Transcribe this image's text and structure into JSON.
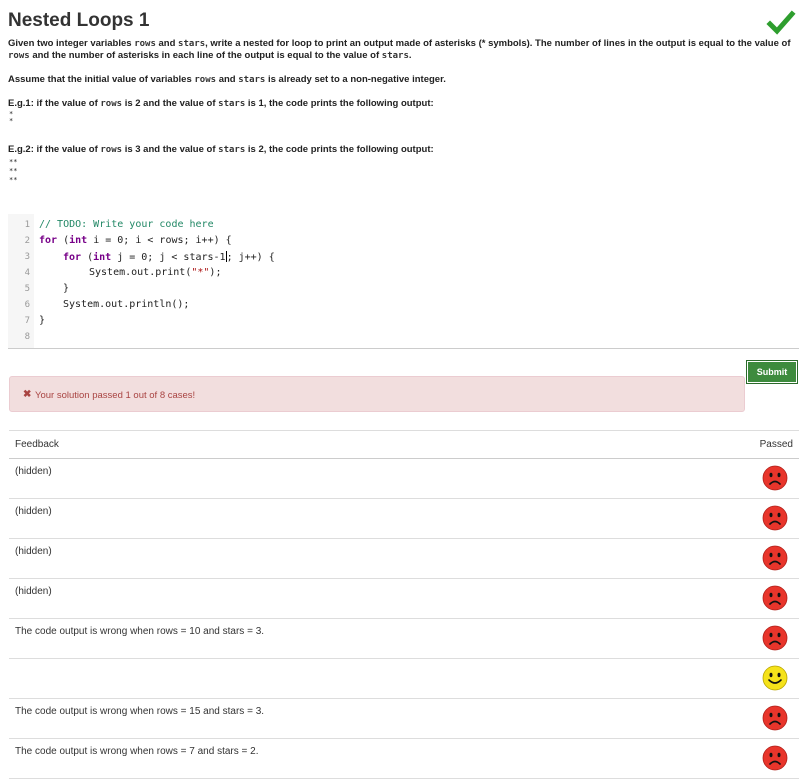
{
  "title": "Nested Loops 1",
  "description": {
    "p1_a": "Given two integer variables ",
    "p1_rows": "rows",
    "p1_b": " and ",
    "p1_stars": "stars",
    "p1_c": ", write a nested for loop to print an output made of asterisks (* symbols). The number of lines in the output is equal to the value of ",
    "p1_rows2": "rows",
    "p1_d": " and the number of asterisks in each line of the output is equal to the value of ",
    "p1_stars2": "stars",
    "p1_e": ".",
    "p2_a": "Assume that the initial value of variables ",
    "p2_rows": "rows",
    "p2_b": " and ",
    "p2_stars": "stars",
    "p2_c": " is already set to a non-negative integer.",
    "eg1_a": "E.g.1: if the value of ",
    "eg1_rows": "rows",
    "eg1_b": " is 2 and the value of ",
    "eg1_stars": "stars",
    "eg1_c": " is 1, the code prints the following output:",
    "eg1_out": [
      "*",
      "*"
    ],
    "eg2_a": "E.g.2: if the value of ",
    "eg2_rows": "rows",
    "eg2_b": " is 3 and the value of ",
    "eg2_stars": "stars",
    "eg2_c": " is 2, the code prints the following output:",
    "eg2_out": [
      "**",
      "**",
      "**"
    ]
  },
  "editor": {
    "line_numbers": [
      "1",
      "2",
      "3",
      "4",
      "5",
      "6",
      "7",
      "8"
    ],
    "lines": {
      "l1": "// TODO: Write your code here",
      "l2_kw1": "for",
      "l2_a": " (",
      "l2_kw2": "int",
      "l2_b": " i = 0; i < rows; i++) {",
      "l3_kw1": "for",
      "l3_a": " (",
      "l3_kw2": "int",
      "l3_b": " j = 0; j < stars-1",
      "l3_c": "; j++) {",
      "l4_a": "System.out.print(",
      "l4_str": "\"*\"",
      "l4_b": ");",
      "l5": "}",
      "l6": "System.out.println();",
      "l7": "}"
    }
  },
  "submit_label": "Submit",
  "alert": {
    "icon": "✖",
    "text": "Your solution passed 1 out of 8 cases!"
  },
  "results": {
    "header_feedback": "Feedback",
    "header_passed": "Passed",
    "rows": [
      {
        "feedback": "(hidden)",
        "passed": false
      },
      {
        "feedback": "(hidden)",
        "passed": false
      },
      {
        "feedback": "(hidden)",
        "passed": false
      },
      {
        "feedback": "(hidden)",
        "passed": false
      },
      {
        "feedback": "The code output is wrong when rows = 10 and stars = 3.",
        "passed": false
      },
      {
        "feedback": "",
        "passed": true
      },
      {
        "feedback": "The code output is wrong when rows = 15 and stars = 3.",
        "passed": false
      },
      {
        "feedback": "The code output is wrong when rows = 7 and stars = 2.",
        "passed": false
      }
    ]
  },
  "colors": {
    "check": "#2e9e2e",
    "sad_face": "#e8352b",
    "happy_face": "#f5e21a",
    "submit_bg": "#3d8b3d",
    "alert_bg": "#f2dede",
    "alert_text": "#a94442"
  },
  "icons": {
    "solved": "check-icon",
    "fail": "sad-face-icon",
    "pass": "happy-face-icon",
    "alert": "x-icon"
  }
}
